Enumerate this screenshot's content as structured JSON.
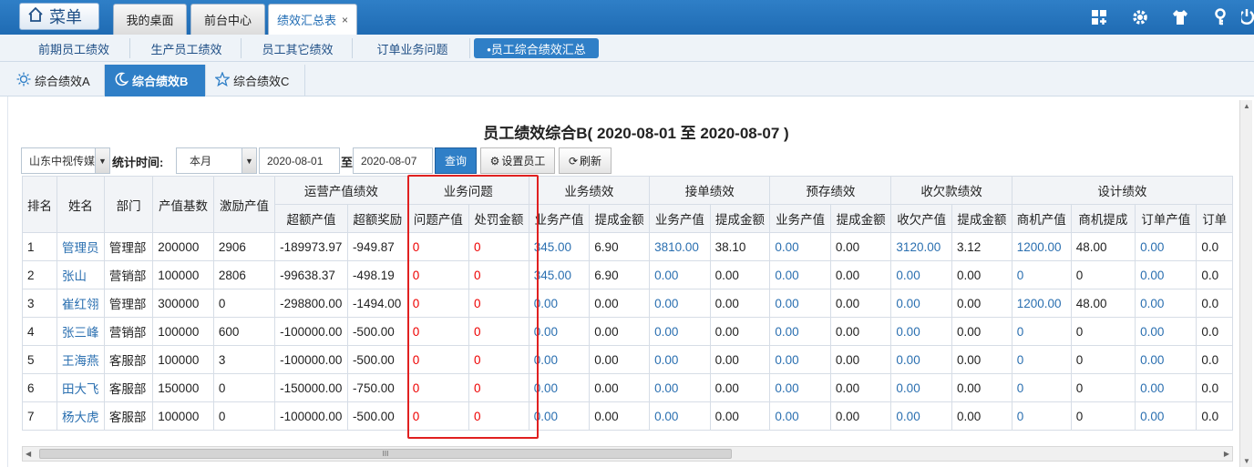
{
  "topbar": {
    "menu_label": "菜单",
    "tabs": [
      {
        "label": "我的桌面"
      },
      {
        "label": "前台中心"
      },
      {
        "label": "绩效汇总表",
        "close": "×"
      }
    ]
  },
  "subnav": {
    "items": [
      {
        "label": "前期员工绩效"
      },
      {
        "label": "生产员工绩效"
      },
      {
        "label": "员工其它绩效"
      },
      {
        "label": "订单业务问题"
      },
      {
        "label": "•员工综合绩效汇总"
      }
    ]
  },
  "viewtabs": [
    {
      "label": "综合绩效A"
    },
    {
      "label": "综合绩效B"
    },
    {
      "label": "综合绩效C"
    }
  ],
  "report": {
    "title": "员工绩效综合B( 2020-08-01 至 2020-08-07 )"
  },
  "filters": {
    "company": "山东中视传媒",
    "time_label": "统计时间:",
    "period": "本月",
    "start_date": "2020-08-01",
    "to_label": "至",
    "end_date": "2020-08-07",
    "query_label": "查询",
    "set_staff_label": "设置员工",
    "refresh_label": "刷新"
  },
  "table": {
    "group_headers": [
      "运营产值绩效",
      "业务问题",
      "业务绩效",
      "接单绩效",
      "预存绩效",
      "收欠款绩效",
      "设计绩效"
    ],
    "fixed_headers": [
      "排名",
      "姓名",
      "部门",
      "产值基数",
      "激励产值"
    ],
    "sub_headers": [
      "超额产值",
      "超额奖励",
      "问题产值",
      "处罚金额",
      "业务产值",
      "提成金额",
      "业务产值",
      "提成金额",
      "业务产值",
      "提成金额",
      "收欠产值",
      "提成金额",
      "商机产值",
      "商机提成",
      "订单产值",
      "订单"
    ],
    "rows": [
      [
        "1",
        "管理员",
        "管理部",
        "200000",
        "2906",
        "-189973.97",
        "-949.87",
        "0",
        "0",
        "345.00",
        "6.90",
        "3810.00",
        "38.10",
        "0.00",
        "0.00",
        "3120.00",
        "3.12",
        "1200.00",
        "48.00",
        "0.00",
        "0.0"
      ],
      [
        "2",
        "张山",
        "营销部",
        "100000",
        "2806",
        "-99638.37",
        "-498.19",
        "0",
        "0",
        "345.00",
        "6.90",
        "0.00",
        "0.00",
        "0.00",
        "0.00",
        "0.00",
        "0.00",
        "0",
        "0",
        "0.00",
        "0.0"
      ],
      [
        "3",
        "崔红翎",
        "管理部",
        "300000",
        "0",
        "-298800.00",
        "-1494.00",
        "0",
        "0",
        "0.00",
        "0.00",
        "0.00",
        "0.00",
        "0.00",
        "0.00",
        "0.00",
        "0.00",
        "1200.00",
        "48.00",
        "0.00",
        "0.0"
      ],
      [
        "4",
        "张三峰",
        "营销部",
        "100000",
        "600",
        "-100000.00",
        "-500.00",
        "0",
        "0",
        "0.00",
        "0.00",
        "0.00",
        "0.00",
        "0.00",
        "0.00",
        "0.00",
        "0.00",
        "0",
        "0",
        "0.00",
        "0.0"
      ],
      [
        "5",
        "王海燕",
        "客服部",
        "100000",
        "3",
        "-100000.00",
        "-500.00",
        "0",
        "0",
        "0.00",
        "0.00",
        "0.00",
        "0.00",
        "0.00",
        "0.00",
        "0.00",
        "0.00",
        "0",
        "0",
        "0.00",
        "0.0"
      ],
      [
        "6",
        "田大飞",
        "客服部",
        "150000",
        "0",
        "-150000.00",
        "-750.00",
        "0",
        "0",
        "0.00",
        "0.00",
        "0.00",
        "0.00",
        "0.00",
        "0.00",
        "0.00",
        "0.00",
        "0",
        "0",
        "0.00",
        "0.0"
      ],
      [
        "7",
        "杨大虎",
        "客服部",
        "100000",
        "0",
        "-100000.00",
        "-500.00",
        "0",
        "0",
        "0.00",
        "0.00",
        "0.00",
        "0.00",
        "0.00",
        "0.00",
        "0.00",
        "0.00",
        "0",
        "0",
        "0.00",
        "0.0"
      ]
    ]
  },
  "scrollbar": {
    "grip": "III"
  },
  "colors": {
    "accent": "#2f7fc7",
    "link": "#2a6fb0",
    "alert": "#e00000"
  }
}
